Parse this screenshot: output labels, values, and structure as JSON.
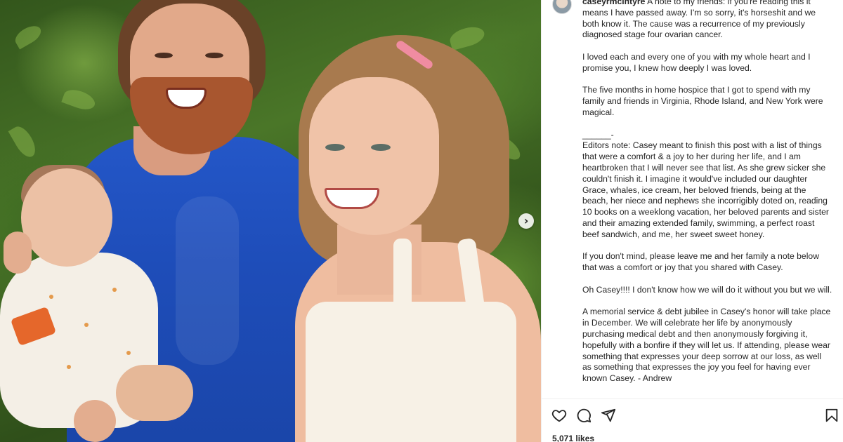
{
  "post": {
    "username": "caseyrmcintyre",
    "caption_paragraphs": [
      "A note to my friends: if you're reading this it means I have passed away. I'm so sorry, it's horseshit and we both know it. The cause was a recurrence of my previously diagnosed stage four ovarian cancer.",
      "I loved each and every one of you with my whole heart and I promise you, I knew how deeply I was loved.",
      "The five months in home hospice that I got to spend with my family and friends in Virginia, Rhode Island, and New York were magical.",
      "______-\nEditors note: Casey meant to finish this post with a list of things that were a comfort & a joy to her during her life, and I am heartbroken that I will never see that list. As she grew sicker she couldn't finish it. I imagine it would've included our daughter Grace, whales, ice cream, her beloved friends, being at the beach, her niece and nephews she incorrigibly doted on, reading 10 books on a weeklong vacation, her beloved parents and sister and their amazing extended family, swimming, a perfect roast beef sandwich, and me, her sweet sweet honey.",
      "If you don't mind, please leave me and her family a note below that was a comfort or joy that you shared with Casey.",
      "Oh Casey!!!! I don't know how we will do it without you but we will.",
      "A memorial service & debt jubilee in Casey's honor will take place in December. We will celebrate her life by anonymously purchasing medical debt and then anonymously forgiving it, hopefully with a bonfire if they will let us. If attending, please wear something that expresses your deep sorrow at our loss, as well as something that expresses the joy you feel for having ever known Casey. - Andrew"
    ],
    "likes": "5,071 likes"
  },
  "icons": {
    "like": "heart-icon",
    "comment": "comment-icon",
    "share": "share-icon",
    "save": "bookmark-icon",
    "next": "chevron-right-icon"
  },
  "carousel": {
    "next_glyph": "›"
  }
}
